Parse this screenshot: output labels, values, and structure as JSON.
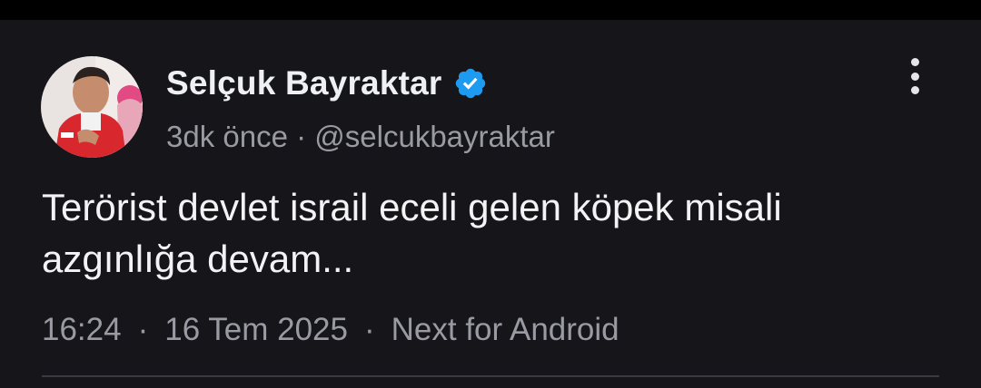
{
  "tweet": {
    "author_name": "Selçuk Bayraktar",
    "relative_time": "3dk önce",
    "meta_separator": "·",
    "handle": "@selcukbayraktar",
    "text_lines": [
      "Terörist devlet israil eceli gelen köpek misali",
      "azgınlığa devam..."
    ],
    "time": "16:24",
    "date": "16 Tem 2025",
    "footer_separator": "·",
    "client": "Next for Android"
  },
  "icons": {
    "verified": "verified-badge-icon",
    "more": "more-vertical-icon",
    "avatar": "profile-photo"
  },
  "colors": {
    "background": "#15151a",
    "verified_badge": "#1d9bf0",
    "primary_text": "#eef0f3",
    "secondary_text": "#9a9aa3"
  }
}
